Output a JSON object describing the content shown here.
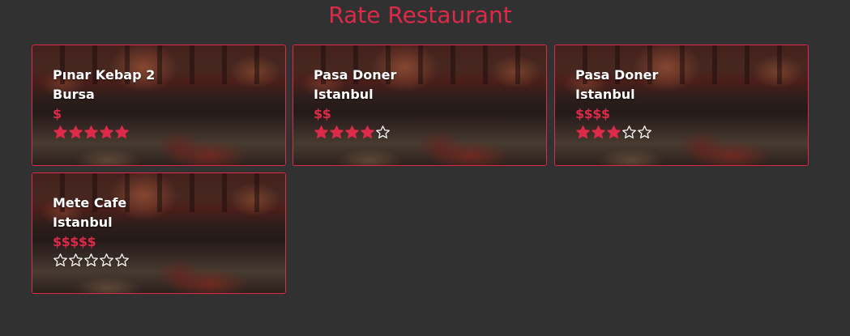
{
  "page": {
    "title": "Rate Restaurant"
  },
  "colors": {
    "background": "#313131",
    "accent": "#dc2a48",
    "text": "#ffffff",
    "star_filled": "#dc2a48",
    "star_empty_outline": "#ffffff"
  },
  "restaurants": [
    {
      "name": "Pınar Kebap 2",
      "city": "Bursa",
      "price": "$",
      "rating": 5,
      "max_rating": 5
    },
    {
      "name": "Pasa Doner",
      "city": "Istanbul",
      "price": "$$",
      "rating": 4,
      "max_rating": 5
    },
    {
      "name": "Pasa Doner",
      "city": "Istanbul",
      "price": "$$$$",
      "rating": 3,
      "max_rating": 5
    },
    {
      "name": "Mete Cafe",
      "city": "Istanbul",
      "price": "$$$$$",
      "rating": 0,
      "max_rating": 5
    }
  ]
}
